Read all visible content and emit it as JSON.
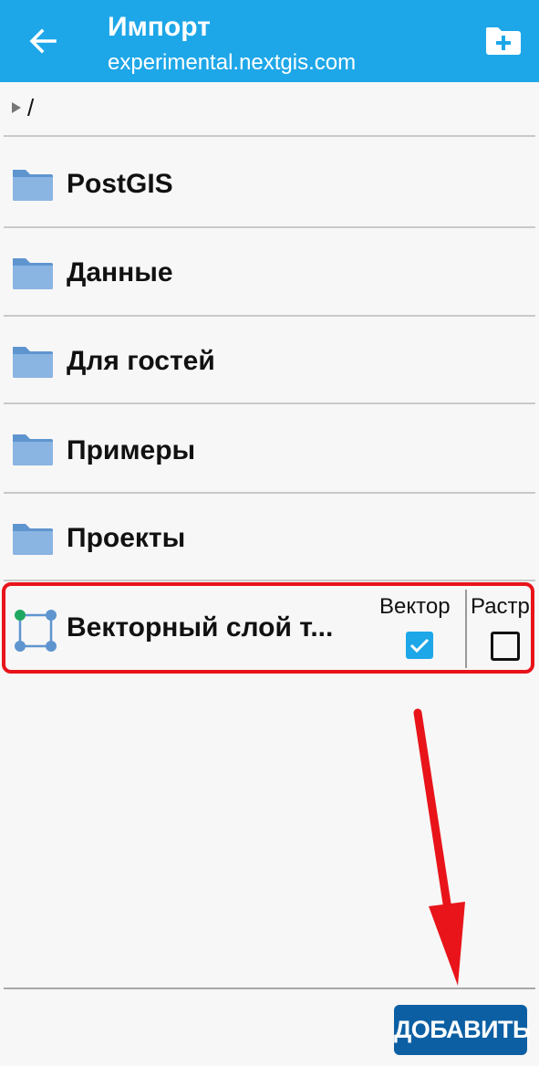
{
  "appbar": {
    "title": "Импорт",
    "subtitle": "experimental.nextgis.com",
    "back_icon": "arrow-left-icon",
    "new_folder_icon": "folder-plus-icon",
    "background": "#1ea7e8"
  },
  "breadcrumb": {
    "path": "/"
  },
  "folders": [
    {
      "label": "PostGIS",
      "icon": "folder-icon"
    },
    {
      "label": "Данные",
      "icon": "folder-icon"
    },
    {
      "label": "Для гостей",
      "icon": "folder-icon"
    },
    {
      "label": "Примеры",
      "icon": "folder-icon"
    },
    {
      "label": "Проекты",
      "icon": "folder-icon"
    }
  ],
  "layer": {
    "label": "Векторный слой т...",
    "icon": "vector-layer-icon",
    "columns": [
      {
        "label": "Вектор",
        "checked": true
      },
      {
        "label": "Растр",
        "checked": false
      }
    ],
    "highlight_color": "#e8141a"
  },
  "footer": {
    "add_label": "ДОБАВИТЬ",
    "button_color": "#0c5fa3"
  },
  "annotation": {
    "arrow_color": "#e8141a"
  }
}
